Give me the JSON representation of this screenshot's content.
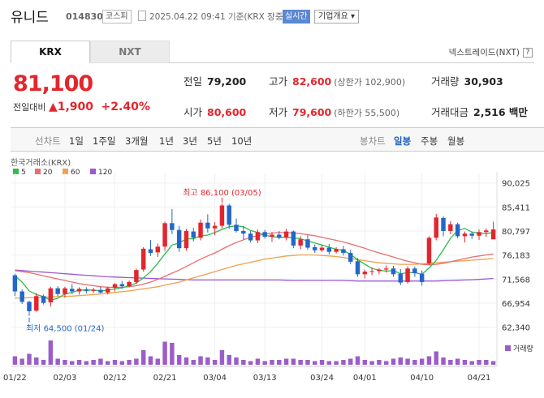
{
  "header": {
    "name": "유니드",
    "code": "014830",
    "market": "코스피",
    "datetime": "2025.04.22 09:41 기준(KRX 장중)",
    "realtime_label": "실시간",
    "company_info_label": "기업개요 ▾"
  },
  "tabs": [
    "KRX",
    "NXT"
  ],
  "nextrade_label": "넥스트레이드(NXT)",
  "nextrade_help": "?",
  "quote": {
    "price": "81,100",
    "change_label": "전일대비",
    "change": "▲1,900",
    "change_pct": "+2.40%"
  },
  "stats": {
    "prev_label": "전일",
    "prev": "79,200",
    "high_label": "고가",
    "high": "82,600",
    "high_sub": "(상한가 102,900)",
    "volume_label": "거래량",
    "volume": "30,903",
    "open_label": "시가",
    "open": "80,600",
    "low_label": "저가",
    "low": "79,600",
    "low_sub": "(하한가 55,500)",
    "amount_label": "거래대금",
    "amount": "2,516 백만"
  },
  "ranges": {
    "label": "선차트",
    "items": [
      "1일",
      "1주일",
      "3개월",
      "1년",
      "3년",
      "5년",
      "10년"
    ],
    "candle_label": "봉차트",
    "candle_items": [
      "일봉",
      "주봉",
      "월봉"
    ],
    "candle_active": "일봉"
  },
  "colors": {
    "up": "#e3262d",
    "down": "#2466c9",
    "ma5": "#2fbb4e",
    "ma20": "#e86f6f",
    "ma60": "#f0a050",
    "ma120": "#9b59d0",
    "volume": "#9b5ec8"
  },
  "chart_data": {
    "type": "candlestick",
    "source_label": "한국거래소(KRX)",
    "legend": [
      {
        "name": "5",
        "color": "#2fbb4e"
      },
      {
        "name": "20",
        "color": "#e86f6f"
      },
      {
        "name": "60",
        "color": "#f0a050"
      },
      {
        "name": "120",
        "color": "#9b59d0"
      }
    ],
    "ylim": [
      61500,
      90600
    ],
    "y_ticks": [
      "90,025",
      "85,411",
      "80,797",
      "76,183",
      "71,568",
      "66,954",
      "62,340"
    ],
    "y_tick_values": [
      90025,
      85411,
      80797,
      76183,
      71568,
      66954,
      62340
    ],
    "x_labels": [
      "01/22",
      "02/03",
      "02/12",
      "02/21",
      "03/04",
      "03/13",
      "03/24",
      "04/01",
      "04/10",
      "04/21"
    ],
    "x_label_index": [
      0,
      7,
      14,
      21,
      28,
      35,
      43,
      49,
      57,
      65
    ],
    "volume_label": "거래량",
    "max_annotation": "최고 86,100 (03/05)",
    "max_index": 29,
    "max_value": 86100,
    "min_annotation": "최저 64,500 (01/24)",
    "min_index": 2,
    "min_value": 64500,
    "candles": [
      [
        72300,
        72600,
        68300,
        69200
      ],
      [
        69200,
        69600,
        66800,
        67200
      ],
      [
        67200,
        67400,
        64500,
        65400
      ],
      [
        65500,
        68900,
        65300,
        68300
      ],
      [
        68300,
        68600,
        66700,
        67000
      ],
      [
        67100,
        70100,
        66300,
        69800
      ],
      [
        69800,
        70200,
        68300,
        68700
      ],
      [
        68700,
        70100,
        68000,
        69800
      ],
      [
        69700,
        70600,
        68700,
        69200
      ],
      [
        69200,
        70000,
        68600,
        69700
      ],
      [
        69600,
        70000,
        68800,
        69300
      ],
      [
        69300,
        69900,
        68900,
        69500
      ],
      [
        69500,
        70100,
        68800,
        69000
      ],
      [
        69000,
        70100,
        68600,
        69800
      ],
      [
        69900,
        70800,
        69200,
        70600
      ],
      [
        70600,
        71200,
        69700,
        70200
      ],
      [
        70200,
        71300,
        70000,
        71000
      ],
      [
        71000,
        73600,
        70600,
        73300
      ],
      [
        73400,
        77700,
        73000,
        77400
      ],
      [
        77300,
        79100,
        76000,
        76600
      ],
      [
        76700,
        78400,
        75800,
        77800
      ],
      [
        77800,
        82600,
        77000,
        82300
      ],
      [
        82300,
        85000,
        80200,
        81000
      ],
      [
        81000,
        81800,
        76800,
        77500
      ],
      [
        77500,
        81200,
        77000,
        80800
      ],
      [
        80700,
        81400,
        78800,
        79500
      ],
      [
        79500,
        83000,
        79000,
        82400
      ],
      [
        82400,
        84000,
        80500,
        81300
      ],
      [
        81300,
        82500,
        80000,
        81800
      ],
      [
        81800,
        86100,
        81300,
        85700
      ],
      [
        85700,
        86000,
        81200,
        82000
      ],
      [
        82000,
        83200,
        80500,
        80800
      ],
      [
        80800,
        81800,
        79200,
        80300
      ],
      [
        80300,
        80800,
        78600,
        79000
      ],
      [
        79000,
        81100,
        78500,
        80600
      ],
      [
        80600,
        81000,
        79300,
        79700
      ],
      [
        79700,
        80600,
        78700,
        80100
      ],
      [
        80100,
        80800,
        79200,
        79500
      ],
      [
        79500,
        81200,
        79000,
        80700
      ],
      [
        80700,
        80900,
        77500,
        78000
      ],
      [
        78000,
        79800,
        77300,
        79200
      ],
      [
        79200,
        80000,
        77200,
        77600
      ],
      [
        77700,
        78200,
        76600,
        77100
      ],
      [
        77100,
        78100,
        76800,
        77600
      ],
      [
        77600,
        78300,
        76300,
        76800
      ],
      [
        76800,
        77700,
        76500,
        77300
      ],
      [
        77300,
        77900,
        76100,
        76600
      ],
      [
        76600,
        77200,
        74400,
        74900
      ],
      [
        75000,
        75600,
        72000,
        72500
      ],
      [
        72500,
        73400,
        71700,
        73000
      ],
      [
        73000,
        73800,
        72300,
        73100
      ],
      [
        73100,
        73700,
        72500,
        73400
      ],
      [
        73400,
        74200,
        72800,
        73600
      ],
      [
        73600,
        74100,
        72000,
        72500
      ],
      [
        72600,
        73500,
        70400,
        70900
      ],
      [
        71000,
        74000,
        70700,
        73600
      ],
      [
        73600,
        74000,
        72000,
        72700
      ],
      [
        72600,
        73200,
        70300,
        71000
      ],
      [
        74500,
        79800,
        74300,
        79500
      ],
      [
        79500,
        84100,
        79000,
        83400
      ],
      [
        83300,
        83600,
        79800,
        80800
      ],
      [
        80800,
        82700,
        80200,
        82100
      ],
      [
        82100,
        82400,
        79400,
        79800
      ],
      [
        79800,
        80700,
        78600,
        80300
      ],
      [
        80300,
        80600,
        79300,
        79900
      ],
      [
        79900,
        81100,
        79100,
        80600
      ],
      [
        80600,
        81300,
        79700,
        80900
      ],
      [
        79200,
        82600,
        79600,
        81100
      ]
    ],
    "volume_rel": [
      0.35,
      0.25,
      0.45,
      0.3,
      0.2,
      1.0,
      0.25,
      0.2,
      0.15,
      0.2,
      0.15,
      0.2,
      0.25,
      0.15,
      0.2,
      0.15,
      0.2,
      0.25,
      0.6,
      0.35,
      0.25,
      0.95,
      0.9,
      0.4,
      0.3,
      0.2,
      0.35,
      0.3,
      0.2,
      0.6,
      0.4,
      0.3,
      0.2,
      0.15,
      0.25,
      0.15,
      0.2,
      0.2,
      0.25,
      0.25,
      0.2,
      0.2,
      0.15,
      0.2,
      0.15,
      0.15,
      0.2,
      0.25,
      0.35,
      0.2,
      0.15,
      0.2,
      0.15,
      0.25,
      0.3,
      0.25,
      0.2,
      0.25,
      0.35,
      0.55,
      0.3,
      0.2,
      0.25,
      0.2,
      0.15,
      0.2,
      0.2,
      0.15
    ],
    "ma5": [
      72200,
      71000,
      69300,
      68600,
      68200,
      67500,
      67900,
      68700,
      69000,
      69500,
      69400,
      69500,
      69300,
      69400,
      69700,
      69900,
      70300,
      70800,
      71800,
      73000,
      74600,
      76400,
      78100,
      78500,
      79300,
      79300,
      79900,
      80000,
      80500,
      81100,
      81600,
      81800,
      81600,
      80900,
      80500,
      80000,
      79700,
      79600,
      79600,
      79500,
      79300,
      78900,
      78500,
      78100,
      77700,
      77300,
      77100,
      76300,
      75300,
      74400,
      73600,
      73300,
      73100,
      73200,
      72600,
      72800,
      72800,
      72500,
      73700,
      75200,
      77200,
      79400,
      80900,
      81300,
      80600,
      80400,
      80300,
      80500
    ],
    "ma20": [
      73200,
      73000,
      72800,
      72500,
      72200,
      71900,
      71600,
      71300,
      71000,
      70700,
      70500,
      70300,
      70100,
      70000,
      70000,
      70000,
      70100,
      70300,
      70600,
      71000,
      71500,
      72100,
      72700,
      73300,
      74000,
      74700,
      75400,
      76000,
      76600,
      77300,
      78000,
      78600,
      79100,
      79600,
      79900,
      80200,
      80400,
      80500,
      80500,
      80400,
      80300,
      80100,
      79900,
      79600,
      79300,
      79000,
      78700,
      78300,
      77900,
      77500,
      77000,
      76600,
      76200,
      75800,
      75400,
      75000,
      74700,
      74400,
      74300,
      74400,
      74600,
      74900,
      75200,
      75500,
      75800,
      76000,
      76200,
      76400
    ],
    "ma60": [
      67900,
      67950,
      68000,
      68050,
      68100,
      68150,
      68200,
      68250,
      68300,
      68400,
      68500,
      68600,
      68700,
      68850,
      69000,
      69150,
      69300,
      69500,
      69700,
      69900,
      70100,
      70400,
      70700,
      71000,
      71400,
      71800,
      72200,
      72600,
      73000,
      73400,
      73800,
      74200,
      74500,
      74800,
      75100,
      75400,
      75600,
      75800,
      76000,
      76100,
      76200,
      76200,
      76200,
      76100,
      76000,
      75900,
      75700,
      75500,
      75300,
      75100,
      74900,
      74700,
      74600,
      74500,
      74400,
      74400,
      74400,
      74500,
      74600,
      74700,
      74800,
      74900,
      75000,
      75100,
      75200,
      75300,
      75400,
      75500
    ],
    "ma120": [
      73300,
      73200,
      73100,
      73000,
      72900,
      72800,
      72700,
      72600,
      72500,
      72400,
      72300,
      72200,
      72100,
      72000,
      71950,
      71900,
      71850,
      71800,
      71750,
      71700,
      71650,
      71600,
      71550,
      71500,
      71450,
      71400,
      71400,
      71400,
      71400,
      71400,
      71400,
      71400,
      71400,
      71400,
      71400,
      71400,
      71400,
      71400,
      71350,
      71300,
      71300,
      71300,
      71300,
      71300,
      71300,
      71300,
      71300,
      71250,
      71200,
      71200,
      71200,
      71200,
      71200,
      71200,
      71200,
      71200,
      71200,
      71200,
      71200,
      71200,
      71250,
      71300,
      71350,
      71400,
      71450,
      71500,
      71600,
      71700
    ]
  }
}
